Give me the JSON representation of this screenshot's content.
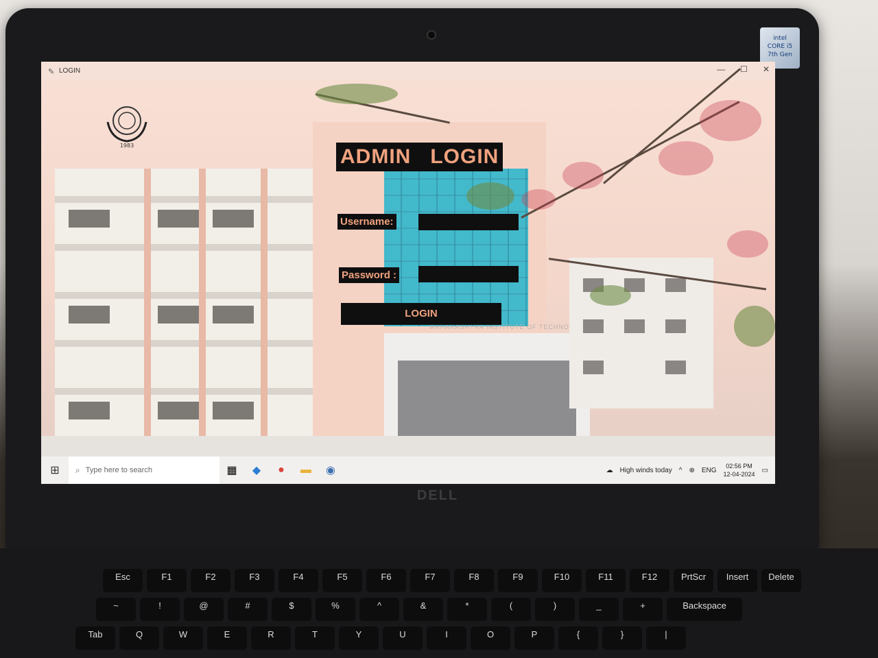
{
  "window": {
    "title": "LOGIN",
    "controls": [
      "—",
      "☐",
      "✕"
    ]
  },
  "form": {
    "heading": "ADMIN   LOGIN",
    "username_label": "Username:",
    "username_value": "",
    "password_label": "Password :",
    "password_value": "",
    "login_button": "LOGIN"
  },
  "logo": {
    "caption": "1983"
  },
  "building_sign": "MAHARASHTRA INSTITUTE OF TECHNOLOGY",
  "taskbar": {
    "search_placeholder": "Type here to search",
    "weather": "High winds today",
    "language": "ENG",
    "time": "02:56 PM",
    "date": "12-04-2024",
    "pinned": [
      "task-view-icon",
      "vscode-icon",
      "chrome-icon",
      "file-explorer-icon",
      "python-app-icon"
    ]
  },
  "laptop": {
    "brand": "DELL",
    "sticker": "intel\nCORE i5\n7th Gen"
  },
  "keys": {
    "row1": [
      "Esc",
      "F1",
      "F2",
      "F3",
      "F4",
      "F5",
      "F6",
      "F7",
      "F8",
      "F9",
      "F10",
      "F11",
      "F12",
      "PrtScr",
      "Insert",
      "Delete"
    ],
    "row2": [
      "~",
      "!",
      "@",
      "#",
      "$",
      "%",
      "^",
      "&",
      "*",
      "(",
      ")",
      "_",
      "+",
      "Backspace"
    ],
    "row3": [
      "Tab",
      "Q",
      "W",
      "E",
      "R",
      "T",
      "Y",
      "U",
      "I",
      "O",
      "P",
      "{",
      "}",
      "|"
    ]
  },
  "colors": {
    "label_text": "#f0a27e",
    "label_bg": "#0f0f10",
    "glass": "#43b9cc"
  }
}
